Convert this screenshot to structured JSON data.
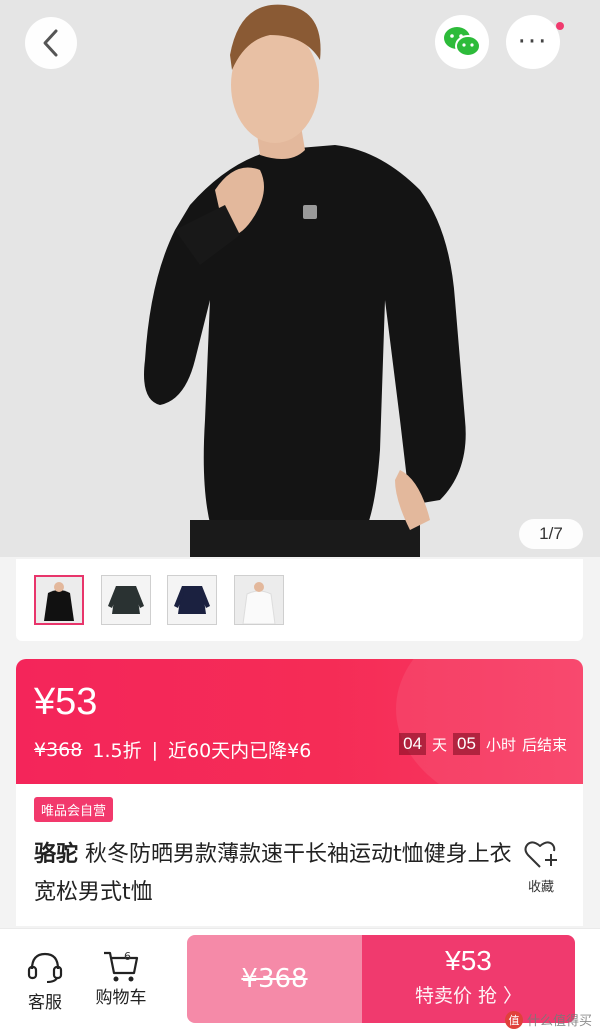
{
  "gallery": {
    "counter": "1/7",
    "thumbnails": [
      "black",
      "dark-grey",
      "navy",
      "white"
    ]
  },
  "header": {
    "back_icon": "chevron-left-icon",
    "share_icon": "wechat-icon",
    "more_icon": "more-dots-icon",
    "more_symbol": "···"
  },
  "price": {
    "current": "¥53",
    "original": "¥368",
    "discount": "1.5折",
    "separator": "|",
    "drop_note": "近60天内已降¥6",
    "countdown": {
      "days": "04",
      "days_unit": "天",
      "hours": "05",
      "hours_unit": "小时",
      "suffix": "后结束"
    }
  },
  "product": {
    "badge": "唯品会自营",
    "brand": "骆驼",
    "title": " 秋冬防晒男款薄款速干长袖运动t恤健身上衣宽松男式t恤",
    "favorite_label": "收藏"
  },
  "bottom_bar": {
    "service_label": "客服",
    "cart_label": "购物车",
    "cart_count": "6",
    "original_price": "¥368",
    "buy_price": "¥53",
    "buy_label": "特卖价 抢 〉"
  },
  "watermark": {
    "logo": "值",
    "text": "什么值得买"
  },
  "colors": {
    "accent": "#f03a6e",
    "banner": "#f4255a",
    "original_button": "#f58aa8"
  }
}
